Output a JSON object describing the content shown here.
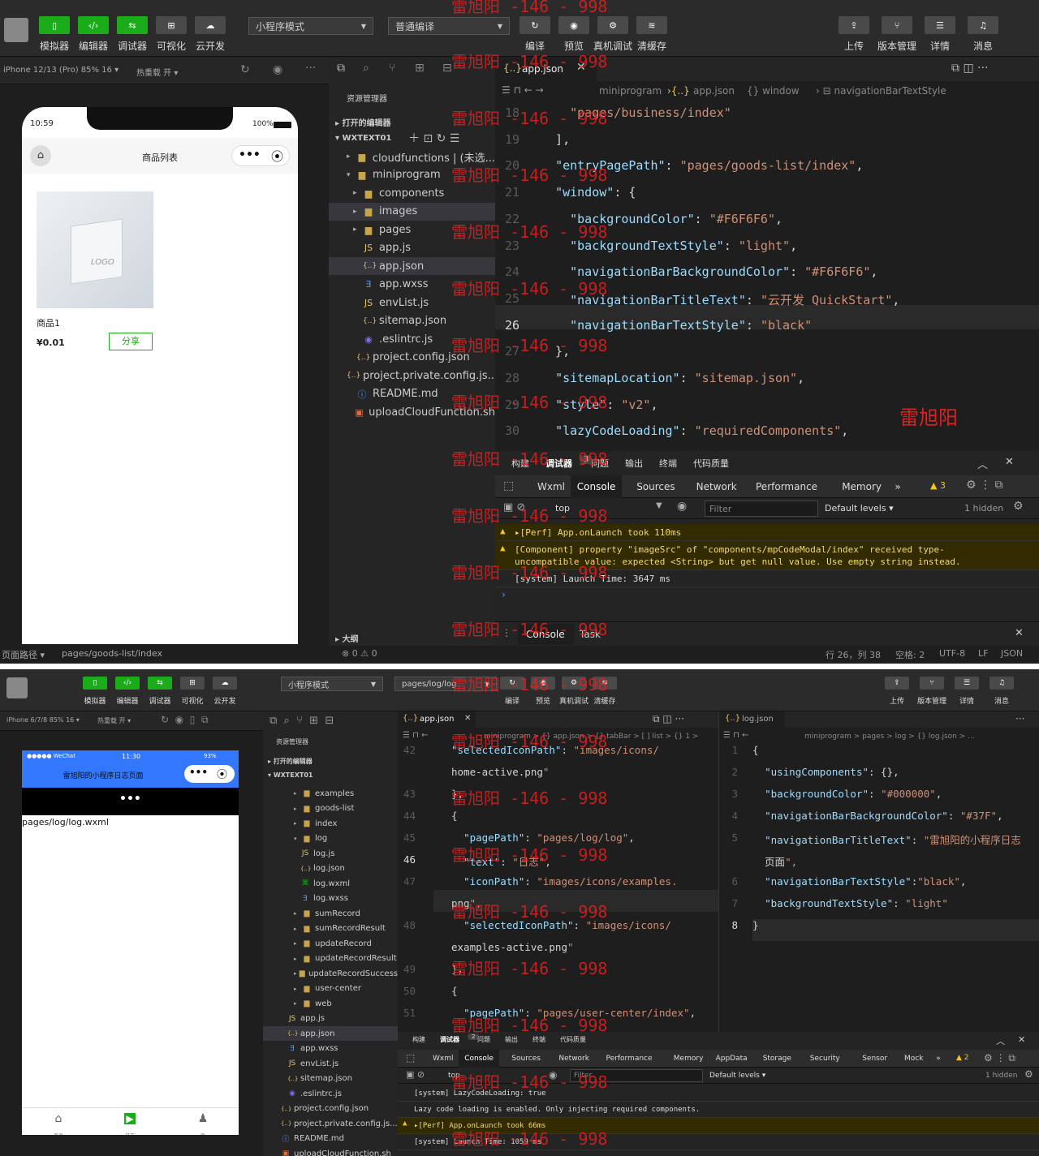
{
  "watermark": {
    "text": "雷旭阳 -146 - 998",
    "signature": "雷旭阳"
  },
  "ide1": {
    "toolbar": {
      "left_buttons": [
        "模拟器",
        "编辑器",
        "调试器",
        "可视化",
        "云开发"
      ],
      "mode_select": "小程序模式",
      "compile_select": "普通编译",
      "mid_buttons": [
        "编译",
        "预览",
        "真机调试",
        "清缓存"
      ],
      "right_buttons": [
        "上传",
        "版本管理",
        "详情",
        "消息"
      ]
    },
    "device_bar": {
      "device": "iPhone 12/13 (Pro) 85% 16 ▾",
      "hot_reload": "热重载 开 ▾"
    },
    "phone": {
      "time": "10:59",
      "battery": "100%",
      "nav_title": "商品列表",
      "logo": "LOGO",
      "product_name": "商品1",
      "price": "¥0.01",
      "share_button": "分享"
    },
    "sim_status": {
      "path_label": "页面路径 ▾",
      "path": "pages/goods-list/index"
    },
    "explorer": {
      "title": "资源管理器",
      "open_editors": "打开的编辑器",
      "project": "WXTEXT01",
      "outline": "大纲",
      "items": [
        {
          "name": "cloudfunctions | (未选...",
          "icon": "folder-icon"
        },
        {
          "name": "miniprogram",
          "icon": "folder-open-icon"
        },
        {
          "name": "components",
          "icon": "folder-icon"
        },
        {
          "name": "images",
          "icon": "folder-icon"
        },
        {
          "name": "pages",
          "icon": "folder-icon"
        },
        {
          "name": "app.js",
          "icon": "js-icon"
        },
        {
          "name": "app.json",
          "icon": "json-icon"
        },
        {
          "name": "app.wxss",
          "icon": "wxss-icon"
        },
        {
          "name": "envList.js",
          "icon": "js-icon"
        },
        {
          "name": "sitemap.json",
          "icon": "json-icon"
        },
        {
          "name": ".eslintrc.js",
          "icon": "eslint-icon"
        },
        {
          "name": "project.config.json",
          "icon": "json-icon"
        },
        {
          "name": "project.private.config.js...",
          "icon": "json-icon"
        },
        {
          "name": "README.md",
          "icon": "info-icon"
        },
        {
          "name": "uploadCloudFunction.sh",
          "icon": "sh-icon"
        }
      ]
    },
    "editor": {
      "tab": "app.json",
      "breadcrumb": [
        "miniprogram",
        "app.json",
        "{} window",
        "navigationBarTextStyle"
      ],
      "lines": [
        {
          "n": "18",
          "t": "    \"pages/business/index\""
        },
        {
          "n": "19",
          "t": "  ],"
        },
        {
          "n": "20",
          "t": "  \"entryPagePath\": \"pages/goods-list/index\","
        },
        {
          "n": "21",
          "t": "  \"window\": {"
        },
        {
          "n": "22",
          "t": "    \"backgroundColor\": \"#F6F6F6\","
        },
        {
          "n": "23",
          "t": "    \"backgroundTextStyle\": \"light\","
        },
        {
          "n": "24",
          "t": "    \"navigationBarBackgroundColor\": \"#F6F6F6\","
        },
        {
          "n": "25",
          "t": "    \"navigationBarTitleText\": \"云开发 QuickStart\","
        },
        {
          "n": "26",
          "t": "    \"navigationBarTextStyle\": \"black\""
        },
        {
          "n": "27",
          "t": "  },"
        },
        {
          "n": "28",
          "t": "  \"sitemapLocation\": \"sitemap.json\","
        },
        {
          "n": "29",
          "t": "  \"style\": \"v2\","
        },
        {
          "n": "30",
          "t": "  \"lazyCodeLoading\": \"requiredComponents\","
        }
      ]
    },
    "console": {
      "top_tabs": [
        "构建",
        "调试器",
        "问题",
        "输出",
        "终端",
        "代码质量"
      ],
      "debugger_count": "3",
      "devtools_tabs": [
        "Wxml",
        "Console",
        "Sources",
        "Network",
        "Performance",
        "Memory",
        "»"
      ],
      "warn_count": "3",
      "context": "top",
      "filter_placeholder": "Filter",
      "levels": "Default levels ▾",
      "hidden": "1 hidden",
      "messages": [
        {
          "type": "warn",
          "text": "▸[Perf] App.onLaunch took 110ms"
        },
        {
          "type": "warn",
          "text": "[Component] property \"imageSrc\" of \"components/mpCodeModal/index\" received type-\nuncompatible value: expected <String> but get null value. Use empty string instead."
        },
        {
          "type": "info",
          "text": "[system] Launch Time: 3647 ms"
        }
      ],
      "bottom_tabs": [
        "Console",
        "Task"
      ]
    },
    "status": {
      "errors": "⊗ 0 ⚠ 0",
      "pos": "行 26，列 38",
      "spaces": "空格: 2",
      "enc": "UTF-8",
      "eol": "LF",
      "lang": "JSON"
    }
  },
  "ide2": {
    "toolbar": {
      "left_buttons": [
        "模拟器",
        "编辑器",
        "调试器",
        "可视化",
        "云开发"
      ],
      "mode_select": "小程序模式",
      "compile_select": "pages/log/log",
      "mid_buttons": [
        "编译",
        "预览",
        "真机调试",
        "清缓存"
      ],
      "right_buttons": [
        "上传",
        "版本管理",
        "详情",
        "消息"
      ]
    },
    "device_bar": {
      "device": "iPhone 6/7/8 85% 16 ▾",
      "hot_reload": "热重载 开 ▾"
    },
    "phone": {
      "carrier": "●●●●● WeChat",
      "time": "11:30",
      "battery": "93%",
      "nav_title": "雷旭阳的小程序日志页面",
      "page_text": "pages/log/log.wxml",
      "tabs": [
        "首页",
        "日志",
        "我"
      ]
    },
    "explorer": {
      "title": "资源管理器",
      "open_editors": "打开的编辑器",
      "project": "WXTEXT01",
      "items": [
        {
          "name": "examples",
          "icon": "folder-icon",
          "indent": 2
        },
        {
          "name": "goods-list",
          "icon": "folder-icon",
          "indent": 2
        },
        {
          "name": "index",
          "icon": "folder-icon",
          "indent": 2
        },
        {
          "name": "log",
          "icon": "folder-open-icon",
          "indent": 2
        },
        {
          "name": "log.js",
          "icon": "js-icon",
          "indent": 3
        },
        {
          "name": "log.json",
          "icon": "json-icon",
          "indent": 3
        },
        {
          "name": "log.wxml",
          "icon": "wxml-icon",
          "indent": 3
        },
        {
          "name": "log.wxss",
          "icon": "wxss-icon",
          "indent": 3
        },
        {
          "name": "sumRecord",
          "icon": "folder-icon",
          "indent": 2
        },
        {
          "name": "sumRecordResult",
          "icon": "folder-icon",
          "indent": 2
        },
        {
          "name": "updateRecord",
          "icon": "folder-icon",
          "indent": 2
        },
        {
          "name": "updateRecordResult",
          "icon": "folder-icon",
          "indent": 2
        },
        {
          "name": "updateRecordSuccess",
          "icon": "folder-icon",
          "indent": 2
        },
        {
          "name": "user-center",
          "icon": "folder-icon",
          "indent": 2
        },
        {
          "name": "web",
          "icon": "folder-icon",
          "indent": 2
        },
        {
          "name": "app.js",
          "icon": "js-icon",
          "indent": 1
        },
        {
          "name": "app.json",
          "icon": "json-icon",
          "indent": 1
        },
        {
          "name": "app.wxss",
          "icon": "wxss-icon",
          "indent": 1
        },
        {
          "name": "envList.js",
          "icon": "js-icon",
          "indent": 1
        },
        {
          "name": "sitemap.json",
          "icon": "json-icon",
          "indent": 1
        },
        {
          "name": ".eslintrc.js",
          "icon": "eslint-icon",
          "indent": 1
        },
        {
          "name": "project.config.json",
          "icon": "json-icon",
          "indent": 0
        },
        {
          "name": "project.private.config.js...",
          "icon": "json-icon",
          "indent": 0
        },
        {
          "name": "README.md",
          "icon": "info-icon",
          "indent": 0
        },
        {
          "name": "uploadCloudFunction.sh",
          "icon": "sh-icon",
          "indent": 0
        }
      ]
    },
    "editor_left": {
      "tab": "app.json",
      "breadcrumb": "miniprogram > {} app.json > {} tabBar > [ ] list > {} 1 >",
      "lines": [
        {
          "n": "42",
          "t": "\"selectedIconPath\": \"images/icons/"
        },
        {
          "n": "",
          "t": "home-active.png\""
        },
        {
          "n": "43",
          "t": "},"
        },
        {
          "n": "44",
          "t": "{"
        },
        {
          "n": "45",
          "t": "  \"pagePath\": \"pages/log/log\","
        },
        {
          "n": "46",
          "t": "  \"text\": \"日志\","
        },
        {
          "n": "47",
          "t": "  \"iconPath\": \"images/icons/examples."
        },
        {
          "n": "",
          "t": "png\","
        },
        {
          "n": "48",
          "t": "  \"selectedIconPath\": \"images/icons/"
        },
        {
          "n": "",
          "t": "examples-active.png\""
        },
        {
          "n": "49",
          "t": "},"
        },
        {
          "n": "50",
          "t": "{"
        },
        {
          "n": "51",
          "t": "  \"pagePath\": \"pages/user-center/index\","
        }
      ]
    },
    "editor_right": {
      "tab": "log.json",
      "breadcrumb": "miniprogram > pages > log > {} log.json > ...",
      "lines": [
        {
          "n": "1",
          "t": "{"
        },
        {
          "n": "2",
          "t": "  \"usingComponents\": {},"
        },
        {
          "n": "3",
          "t": "  \"backgroundColor\": \"#000000\","
        },
        {
          "n": "4",
          "t": "  \"navigationBarBackgroundColor\": \"#37F\","
        },
        {
          "n": "5",
          "t": "  \"navigationBarTitleText\": \"雷旭阳的小程序日志"
        },
        {
          "n": "",
          "t": "  页面\","
        },
        {
          "n": "6",
          "t": "  \"navigationBarTextStyle\":\"black\","
        },
        {
          "n": "7",
          "t": "  \"backgroundTextStyle\": \"light\""
        },
        {
          "n": "8",
          "t": "}"
        }
      ]
    },
    "console": {
      "top_tabs": [
        "构建",
        "调试器",
        "问题",
        "输出",
        "终端",
        "代码质量"
      ],
      "debugger_count": "2",
      "devtools_tabs": [
        "Wxml",
        "Console",
        "Sources",
        "Network",
        "Performance",
        "Memory",
        "AppData",
        "Storage",
        "Security",
        "Sensor",
        "Mock",
        "»"
      ],
      "warn_count": "2",
      "context": "top",
      "filter_placeholder": "Filter",
      "levels": "Default levels ▾",
      "hidden": "1 hidden",
      "messages": [
        {
          "type": "info",
          "text": "[system] LazyCodeLoading: true"
        },
        {
          "type": "info",
          "text": "Lazy code loading is enabled. Only injecting required components."
        },
        {
          "type": "warn",
          "text": "▸[Perf] App.onLaunch took 66ms"
        },
        {
          "type": "info",
          "text": "[system] Launch Time: 1059 ms"
        }
      ]
    }
  },
  "colors": {
    "accent_green": "#1aad19",
    "nav_blue": "#3377ff",
    "warn_bg": "#332b00",
    "watermark": "#e02020"
  }
}
